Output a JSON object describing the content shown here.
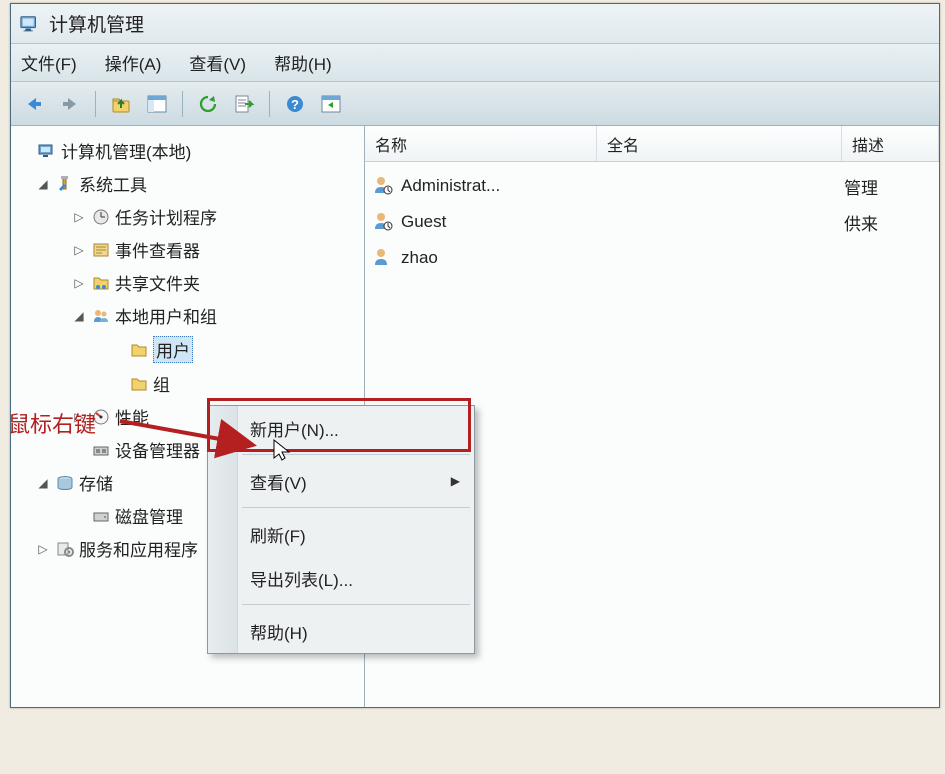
{
  "window": {
    "title": "计算机管理"
  },
  "menubar": {
    "file": "文件(F)",
    "action": "操作(A)",
    "view": "查看(V)",
    "help": "帮助(H)"
  },
  "tree": {
    "root": "计算机管理(本地)",
    "system_tools": "系统工具",
    "task_scheduler": "任务计划程序",
    "event_viewer": "事件查看器",
    "shared_folders": "共享文件夹",
    "local_users_groups": "本地用户和组",
    "users": "用户",
    "groups": "组",
    "performance": "性能",
    "device_manager": "设备管理器",
    "storage": "存储",
    "disk_management": "磁盘管理",
    "services_apps": "服务和应用程序"
  },
  "list": {
    "header_name": "名称",
    "header_fullname": "全名",
    "header_description": "描述",
    "rows": [
      {
        "name": "Administrat...",
        "desc": "管理"
      },
      {
        "name": "Guest",
        "desc": "供来"
      },
      {
        "name": "zhao",
        "desc": ""
      }
    ]
  },
  "context_menu": {
    "new_user": "新用户(N)...",
    "view": "查看(V)",
    "refresh": "刷新(F)",
    "export_list": "导出列表(L)...",
    "help": "帮助(H)"
  },
  "annotation": {
    "label": "鼠标右键"
  }
}
